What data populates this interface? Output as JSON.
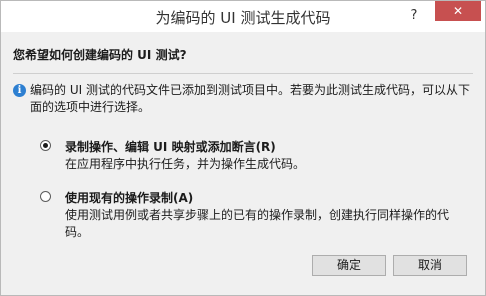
{
  "window": {
    "title": "为编码的 UI 测试生成代码",
    "help": "?",
    "close": "✕"
  },
  "question": "您希望如何创建编码的 UI 测试?",
  "info": {
    "icon": "info-icon",
    "text": "编码的 UI 测试的代码文件已添加到测试项目中。若要为此测试生成代码，可以从下面的选项中进行选择。"
  },
  "options": [
    {
      "title": "录制操作、编辑 UI 映射或添加断言(R)",
      "description": "在应用程序中执行任务，并为操作生成代码。",
      "selected": true
    },
    {
      "title": "使用现有的操作录制(A)",
      "description": "使用测试用例或者共享步骤上的已有的操作录制，创建执行同样操作的代码。",
      "selected": false
    }
  ],
  "buttons": {
    "ok": "确定",
    "cancel": "取消"
  }
}
